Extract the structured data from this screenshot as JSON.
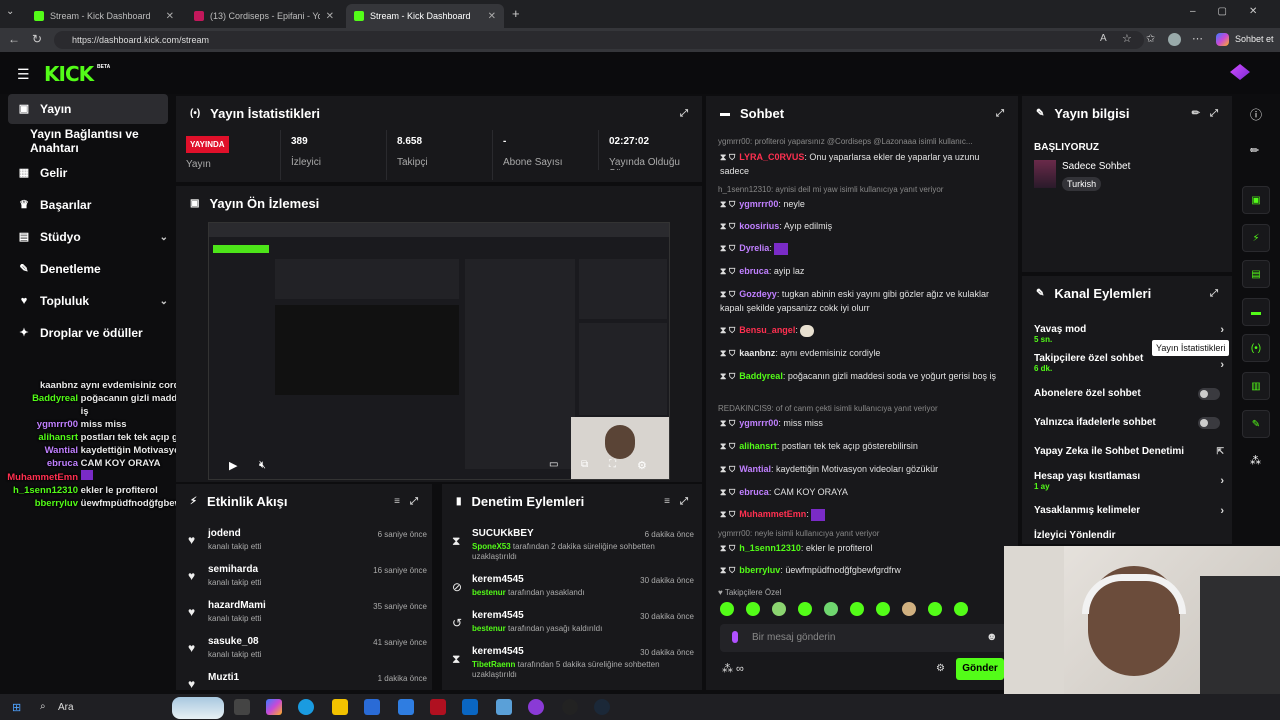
{
  "browser": {
    "tabs": [
      {
        "label": "Stream - Kick Dashboard",
        "active": false
      },
      {
        "label": "(13) Cordiseps - Epifani - YouTube",
        "active": false
      },
      {
        "label": "Stream - Kick Dashboard",
        "active": true
      }
    ],
    "url": "https://dashboard.kick.com/stream",
    "copilot_label": "Sohbet et"
  },
  "logo": "KICK",
  "logo_badge": "BETA",
  "sidebar": {
    "items": [
      {
        "label": "Yayın",
        "icon": "broadcast-icon",
        "active": true
      },
      {
        "label": "Yayın Bağlantısı ve Anahtarı",
        "icon": "",
        "active": false
      },
      {
        "label": "Gelir",
        "icon": "revenue-icon",
        "active": false
      },
      {
        "label": "Başarılar",
        "icon": "trophy-icon",
        "active": false
      },
      {
        "label": "Stüdyo",
        "icon": "studio-icon",
        "active": false
      },
      {
        "label": "Denetleme",
        "icon": "wrench-icon",
        "active": false
      },
      {
        "label": "Topluluk",
        "icon": "community-icon",
        "active": false
      },
      {
        "label": "Droplar ve ödüller",
        "icon": "gift-icon",
        "active": false
      }
    ]
  },
  "overlay_chat": [
    {
      "user": "kaanbnz",
      "text": "aynı evdemisiniz cordiyle",
      "color": "#e8e8e8"
    },
    {
      "user": "Baddyreal",
      "text": "poğacanın gizli maddesi soda ve yoğurt gerisi boş",
      "color": "#53fc18"
    },
    {
      "user": "",
      "text": "iş",
      "color": "#e8e8e8"
    },
    {
      "user": "ygmrrr00",
      "text": "miss miss",
      "color": "#c080ff"
    },
    {
      "user": "alihansrt",
      "text": "postları tek tek açıp gösterebilirsin",
      "color": "#53fc18"
    },
    {
      "user": "Wantial",
      "text": "kaydettiğin Motivasyon videoları gözükür",
      "color": "#c080ff"
    },
    {
      "user": "ebruca",
      "text": "CAM KOY ORAYA",
      "color": "#c080ff"
    },
    {
      "user": "MuhammetEmn",
      "text": "",
      "color": "#ff3050"
    },
    {
      "user": "h_1senn12310",
      "text": "ekler le profiterol",
      "color": "#53fc18"
    },
    {
      "user": "bberryluv",
      "text": "üewfmpüdfnodğfgbewfgrdfrw",
      "color": "#53fc18"
    }
  ],
  "stats": {
    "title": "Yayın İstatistikleri",
    "live": "YAYINDA",
    "live_label": "Yayın",
    "viewers": "389",
    "viewers_label": "İzleyici",
    "followers": "8.658",
    "followers_label": "Takipçi",
    "subs": "-",
    "subs_label": "Abone Sayısı",
    "duration": "02:27:02",
    "duration_label": "Yayında Olduğu Süre"
  },
  "preview": {
    "title": "Yayın Ön İzlemesi"
  },
  "activity": {
    "title": "Etkinlik Akışı",
    "items": [
      {
        "name": "jodend",
        "sub": "kanalı takip etti",
        "time": "6 saniye önce"
      },
      {
        "name": "semiharda",
        "sub": "kanalı takip etti",
        "time": "16 saniye önce"
      },
      {
        "name": "hazardMami",
        "sub": "kanalı takip etti",
        "time": "35 saniye önce"
      },
      {
        "name": "sasuke_08",
        "sub": "kanalı takip etti",
        "time": "41 saniye önce"
      },
      {
        "name": "Muzti1",
        "sub": "",
        "time": "1 dakika önce"
      }
    ]
  },
  "mod_actions": {
    "title": "Denetim Eylemleri",
    "items": [
      {
        "name": "SUCUKkBEY",
        "actor": "SponeX53",
        "text": "tarafından 2 dakika süreliğine sohbetten uzaklaştırıldı",
        "time": "6 dakika önce",
        "icon": "hourglass-icon"
      },
      {
        "name": "kerem4545",
        "actor": "bestenur",
        "text": "tarafından yasaklandı",
        "time": "30 dakika önce",
        "icon": "ban-icon"
      },
      {
        "name": "kerem4545",
        "actor": "bestenur",
        "text": "tarafından yasağı kaldırıldı",
        "time": "30 dakika önce",
        "icon": "undo-icon"
      },
      {
        "name": "kerem4545",
        "actor": "TibetRaenn",
        "text": "tarafından 5 dakika süreliğine sohbetten uzaklaştırıldı",
        "time": "30 dakika önce",
        "icon": "hourglass-icon"
      }
    ]
  },
  "chat": {
    "title": "Sohbet",
    "replies": [
      {
        "text": "ygmrrr00: profiteroi yaparsınız @Cordiseps @Lazonaaa isimli kullanıc..."
      },
      {
        "text": "h_1senn12310: aynisi deil mi yaw isimli kullanıcıya yanıt veriyor"
      },
      {
        "text": "REDAKINCIS9: of of canm çekti isimli kullanıcıya yanıt veriyor"
      },
      {
        "text": "ygmrrr00: neyle isimli kullanıcıya yanıt veriyor"
      }
    ],
    "messages": [
      {
        "user": "LYRA_C0RVUS",
        "text": "Onu yaparlarsa ekler de yaparlar ya uzunu sadece",
        "color": "#ff3050"
      },
      {
        "user": "ygmrrr00",
        "text": "neyle",
        "color": "#c080ff"
      },
      {
        "user": "koosirius",
        "text": "Ayıp edilmiş",
        "color": "#c080ff"
      },
      {
        "user": "Dyrelia",
        "text": "",
        "color": "#c080ff"
      },
      {
        "user": "ebruca",
        "text": "ayip laz",
        "color": "#c080ff"
      },
      {
        "user": "Gozdeyy",
        "text": "tugkan abinin eski yayını gibi gözler ağız ve kulaklar kapalı şekilde yapsanizz cokk iyi olurr",
        "color": "#c080ff"
      },
      {
        "user": "Bensu_angel",
        "text": "",
        "color": "#ff3050"
      },
      {
        "user": "kaanbnz",
        "text": "aynı evdemisiniz cordiyle",
        "color": "#e8e8e8"
      },
      {
        "user": "Baddyreal",
        "text": "poğacanın gizli maddesi soda ve yoğurt gerisi boş iş",
        "color": "#53fc18"
      },
      {
        "user": "ygmrrr00",
        "text": "miss miss",
        "color": "#c080ff"
      },
      {
        "user": "alihansrt",
        "text": "postları tek tek açıp gösterebilirsin",
        "color": "#53fc18"
      },
      {
        "user": "Wantial",
        "text": "kaydettiğin Motivasyon videoları gözükür",
        "color": "#c080ff"
      },
      {
        "user": "ebruca",
        "text": "CAM KOY ORAYA",
        "color": "#c080ff"
      },
      {
        "user": "MuhammetEmn",
        "text": "",
        "color": "#ff3050"
      },
      {
        "user": "h_1senn12310",
        "text": "ekler le profiterol",
        "color": "#53fc18"
      },
      {
        "user": "bberryluv",
        "text": "üewfmpüdfnodğfgbewfgrdfrw",
        "color": "#53fc18"
      }
    ],
    "followers_only": "Takipçilere Özel",
    "placeholder": "Bir mesaj gönderin",
    "send": "Gönder"
  },
  "stream_info": {
    "title": "Yayın bilgisi",
    "stream_title": "BAŞLIYORUZ",
    "category": "Sadece Sohbet",
    "tag": "Turkish"
  },
  "channel_actions": {
    "title": "Kanal Eylemleri",
    "items": [
      {
        "label": "Yavaş mod",
        "sub": "5 sn.",
        "control": "chevron"
      },
      {
        "label": "Takipçilere özel sohbet",
        "sub": "6 dk.",
        "control": "chevron"
      },
      {
        "label": "Abonelere özel sohbet",
        "sub": "",
        "control": "toggle"
      },
      {
        "label": "Yalnızca ifadelerle sohbet",
        "sub": "",
        "control": "toggle"
      },
      {
        "label": "Yapay Zeka ile Sohbet Denetimi",
        "sub": "",
        "control": "external"
      },
      {
        "label": "Hesap yaşı kısıtlaması",
        "sub": "1 ay",
        "control": "chevron"
      },
      {
        "label": "Yasaklanmış kelimeler",
        "sub": "",
        "control": "chevron"
      },
      {
        "label": "İzleyici Yönlendir",
        "sub": "",
        "control": ""
      }
    ],
    "tooltip": "Yayın İstatistikleri"
  },
  "taskbar": {
    "search": "Ara"
  }
}
